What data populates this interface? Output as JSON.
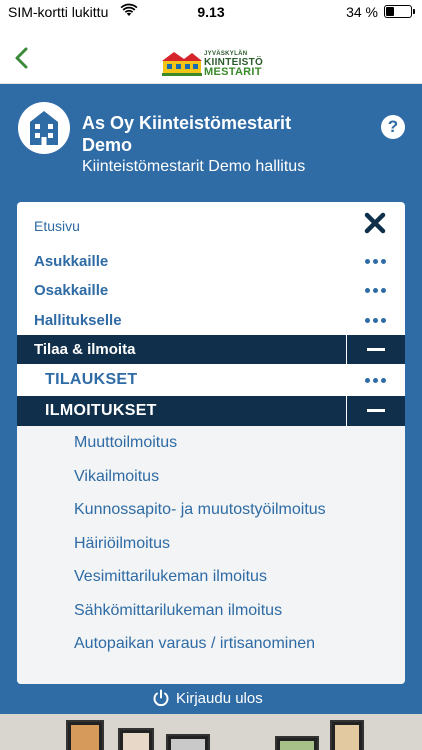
{
  "status_bar": {
    "carrier": "SIM-kortti lukittu",
    "time": "9.13",
    "battery": "34 %"
  },
  "navbar": {
    "logo": {
      "line1": "JYVÄSKYLÄN",
      "line2": "KIINTEISTÖ",
      "line3": "MESTARIT"
    }
  },
  "header": {
    "title": "As Oy Kiinteistömestarit Demo",
    "subtitle": "Kiinteistömestarit Demo hallitus",
    "help": "?"
  },
  "menu": {
    "home": "Etusivu",
    "sections": [
      {
        "label": "Asukkaille"
      },
      {
        "label": "Osakkaille"
      },
      {
        "label": "Hallitukselle"
      }
    ],
    "active_section": "Tilaa & ilmoita",
    "tilaukset": "TILAUKSET",
    "ilmoitukset": "ILMOITUKSET",
    "items": [
      "Muuttoilmoitus",
      "Vikailmoitus",
      "Kunnossapito- ja muutostyöilmoitus",
      "Häiriöilmoitus",
      "Vesimittarilukeman ilmoitus",
      "Sähkömittarilukeman ilmoitus",
      "Autopaikan varaus / irtisanominen"
    ]
  },
  "logout": "Kirjaudu ulos",
  "colors": {
    "primary_blue": "#2f6ba5",
    "dark_navy": "#0f2f4b",
    "back_green": "#3a8a3a"
  }
}
